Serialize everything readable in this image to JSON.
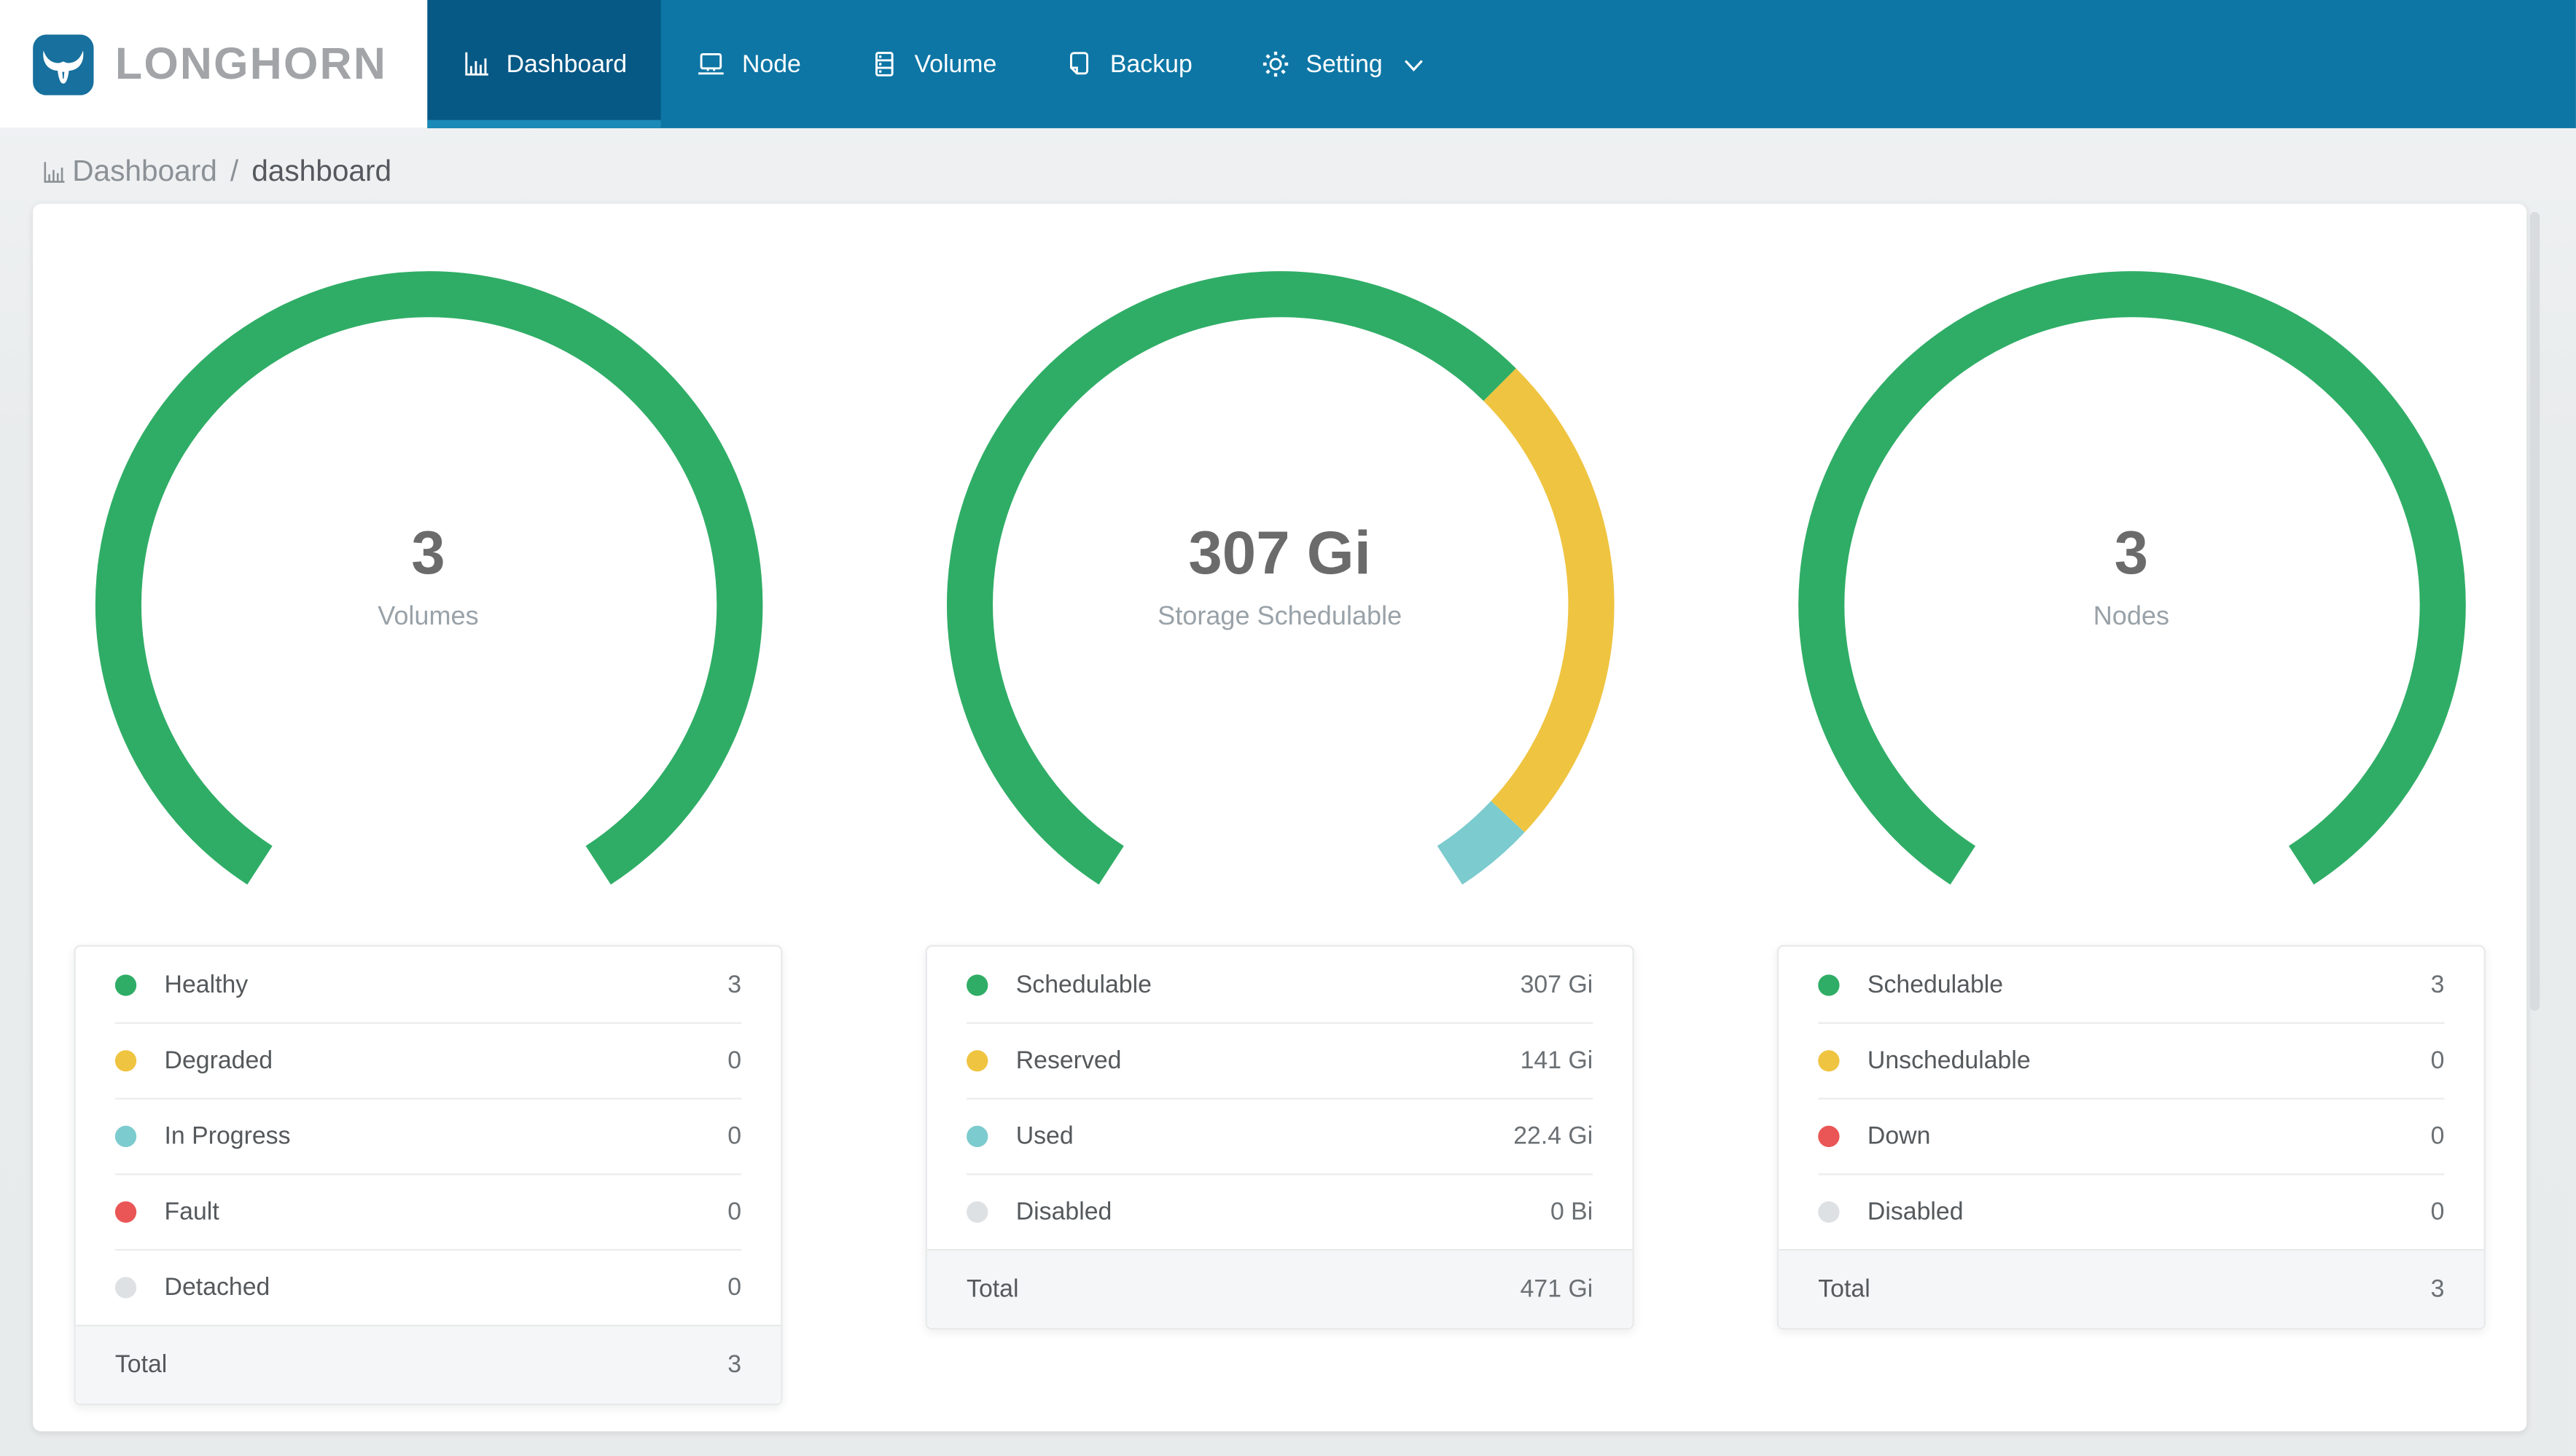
{
  "app": {
    "name": "LONGHORN",
    "logo_color": "#17709d"
  },
  "navbar": {
    "background": "#0d76a5",
    "active_background": "#065885",
    "active_underline": "#1b8ab8",
    "items": [
      {
        "label": "Dashboard",
        "icon": "bar-chart-icon",
        "active": true
      },
      {
        "label": "Node",
        "icon": "laptop-icon",
        "active": false
      },
      {
        "label": "Volume",
        "icon": "server-icon",
        "active": false
      },
      {
        "label": "Backup",
        "icon": "file-copy-icon",
        "active": false
      },
      {
        "label": "Setting",
        "icon": "gear-icon",
        "active": false,
        "has_dropdown": true
      }
    ]
  },
  "breadcrumb": {
    "section": "Dashboard",
    "separator": "/",
    "page": "dashboard"
  },
  "chart_data": [
    {
      "type": "donut-gauge",
      "id": "volumes",
      "center_value": "3",
      "center_label": "Volumes",
      "arc_sweep_deg": 294,
      "arc_start_deg": 213,
      "segments": [
        {
          "label": "Healthy",
          "value": 3,
          "display": "3",
          "color": "#2fad66"
        },
        {
          "label": "Degraded",
          "value": 0,
          "display": "0",
          "color": "#efc440"
        },
        {
          "label": "In Progress",
          "value": 0,
          "display": "0",
          "color": "#7ccbce"
        },
        {
          "label": "Fault",
          "value": 0,
          "display": "0",
          "color": "#e95655"
        },
        {
          "label": "Detached",
          "value": 0,
          "display": "0",
          "color": "#dee1e4"
        }
      ],
      "total": {
        "label": "Total",
        "display": "3"
      }
    },
    {
      "type": "donut-gauge",
      "id": "storage-schedulable",
      "center_value": "307 Gi",
      "center_label": "Storage Schedulable",
      "arc_sweep_deg": 294,
      "arc_start_deg": 213,
      "segments": [
        {
          "label": "Schedulable",
          "value": 307,
          "display": "307 Gi",
          "color": "#2fad66"
        },
        {
          "label": "Reserved",
          "value": 141,
          "display": "141 Gi",
          "color": "#efc440"
        },
        {
          "label": "Used",
          "value": 22.4,
          "display": "22.4 Gi",
          "color": "#7ccbce"
        },
        {
          "label": "Disabled",
          "value": 0,
          "display": "0 Bi",
          "color": "#dee1e4"
        }
      ],
      "total": {
        "label": "Total",
        "display": "471 Gi"
      }
    },
    {
      "type": "donut-gauge",
      "id": "nodes",
      "center_value": "3",
      "center_label": "Nodes",
      "arc_sweep_deg": 294,
      "arc_start_deg": 213,
      "segments": [
        {
          "label": "Schedulable",
          "value": 3,
          "display": "3",
          "color": "#2fad66"
        },
        {
          "label": "Unschedulable",
          "value": 0,
          "display": "0",
          "color": "#efc440"
        },
        {
          "label": "Down",
          "value": 0,
          "display": "0",
          "color": "#e95655"
        },
        {
          "label": "Disabled",
          "value": 0,
          "display": "0",
          "color": "#dee1e4"
        }
      ],
      "total": {
        "label": "Total",
        "display": "3"
      }
    }
  ]
}
